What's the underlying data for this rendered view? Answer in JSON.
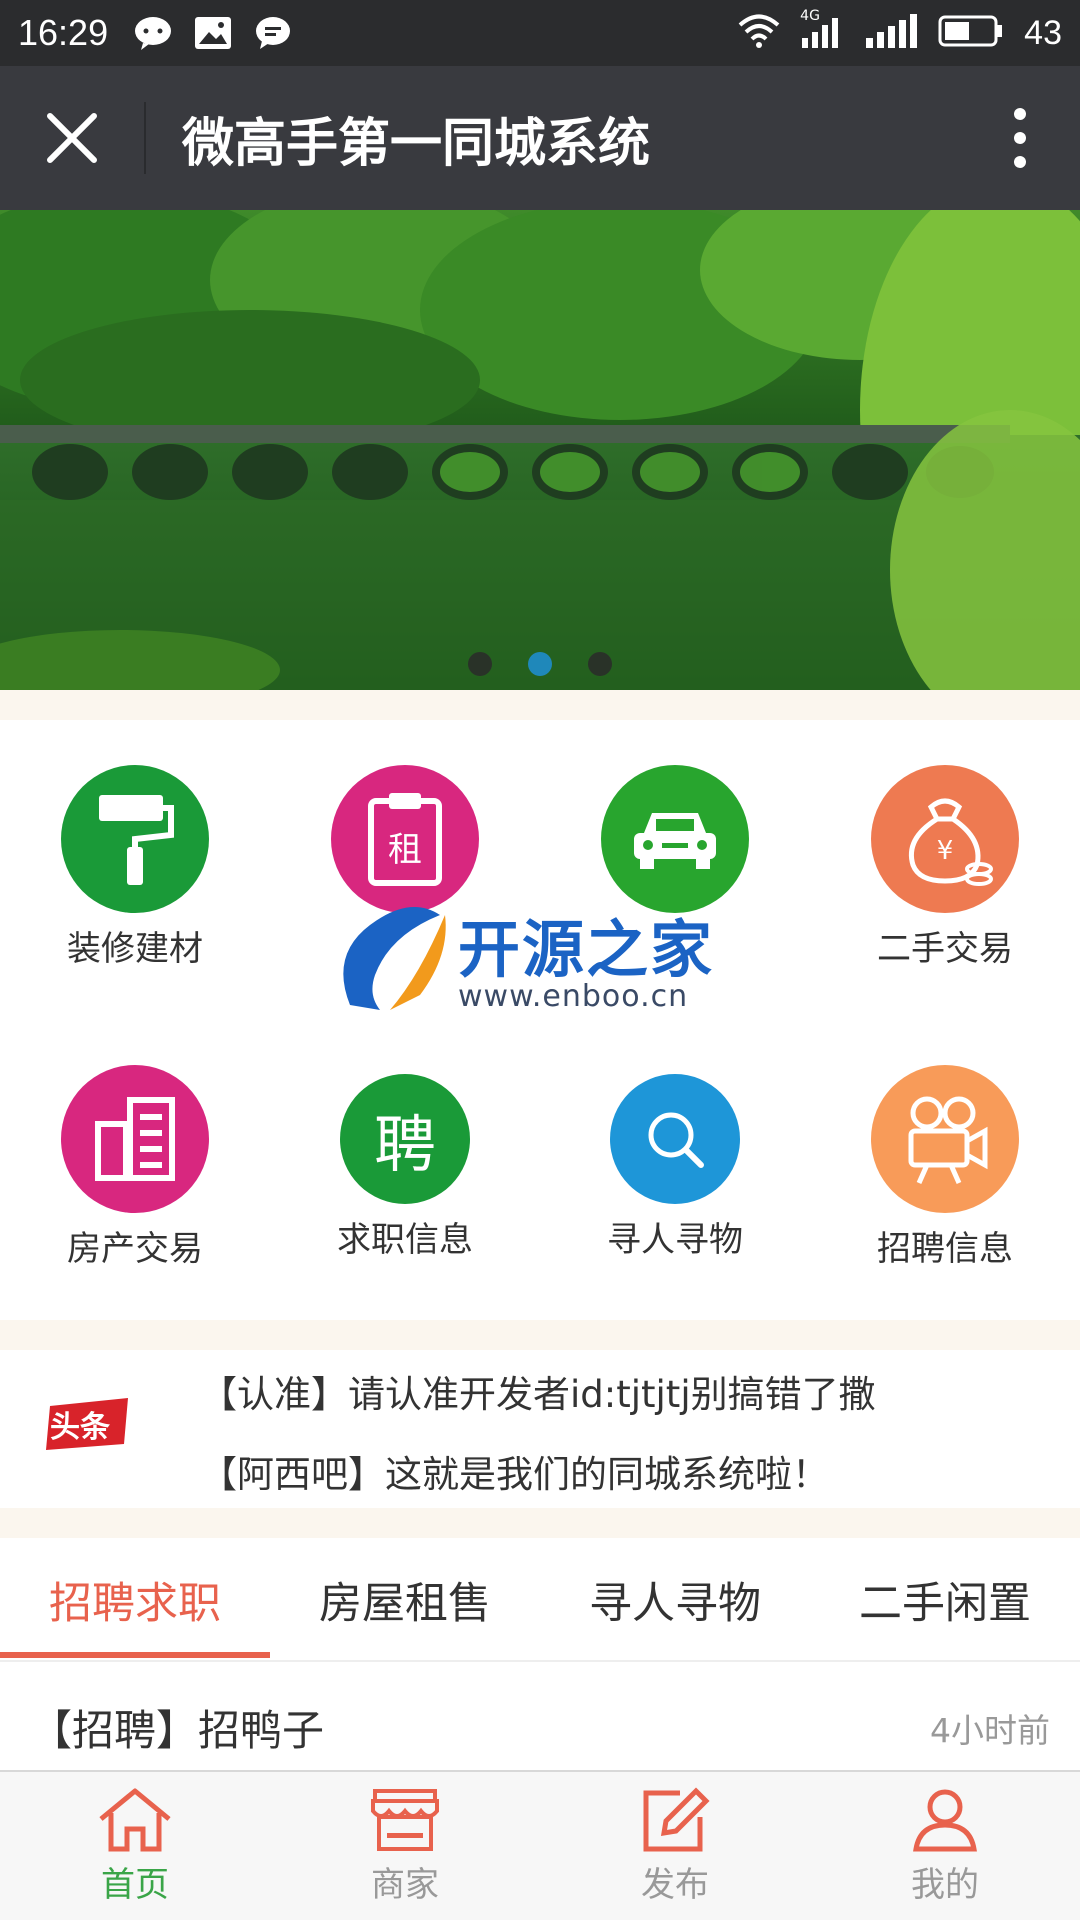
{
  "status_bar": {
    "time": "16:29",
    "network": "4G",
    "battery": "43",
    "icons": [
      "wechat-icon",
      "image-icon",
      "message-icon",
      "wifi-icon",
      "signal-icon",
      "signal-icon",
      "battery-icon"
    ]
  },
  "title_bar": {
    "title": "微高手第一同城系统",
    "close_icon": "close-icon",
    "more_icon": "more-vertical-icon"
  },
  "banner": {
    "slide_count": 3,
    "active_slide": 2
  },
  "menu": {
    "items": [
      {
        "label": "装修建材",
        "icon": "paint-roller-icon",
        "color": "#1a9a38"
      },
      {
        "label": "",
        "icon": "rent-clipboard-icon",
        "color": "#d8277f"
      },
      {
        "label": "",
        "icon": "car-icon",
        "color": "#28a52e"
      },
      {
        "label": "二手交易",
        "icon": "money-bag-icon",
        "color": "#ee7a51"
      },
      {
        "label": "房产交易",
        "icon": "building-icon",
        "color": "#d8277f"
      },
      {
        "label": "求职信息",
        "icon": "hire-icon",
        "glyph": "聘",
        "color": "#1a9a38"
      },
      {
        "label": "寻人寻物",
        "icon": "search-icon",
        "color": "#1e96d8"
      },
      {
        "label": "招聘信息",
        "icon": "video-camera-icon",
        "color": "#f89b59"
      }
    ],
    "rent_glyph": "租"
  },
  "watermark": {
    "brand": "开源之家",
    "url": "www.enboo.cn"
  },
  "headlines": {
    "badge": "头条",
    "items": [
      "【认准】请认准开发者id:tjtjtj别搞错了撒",
      "【阿西吧】这就是我们的同城系统啦！"
    ]
  },
  "tabs": [
    {
      "label": "招聘求职",
      "active": true
    },
    {
      "label": "房屋租售",
      "active": false
    },
    {
      "label": "寻人寻物",
      "active": false
    },
    {
      "label": "二手闲置",
      "active": false
    }
  ],
  "list": [
    {
      "title": "【招聘】招鸭子",
      "time": "4小时前"
    }
  ],
  "bottom_nav": [
    {
      "label": "首页",
      "icon": "home-icon",
      "active": true
    },
    {
      "label": "商家",
      "icon": "shop-icon",
      "active": false
    },
    {
      "label": "发布",
      "icon": "edit-icon",
      "active": false
    },
    {
      "label": "我的",
      "icon": "user-icon",
      "active": false
    }
  ],
  "colors": {
    "accent": "#e8624d",
    "active_nav": "#3aa548",
    "title_bar": "#393a3f",
    "status_bar": "#2b2c2e"
  }
}
